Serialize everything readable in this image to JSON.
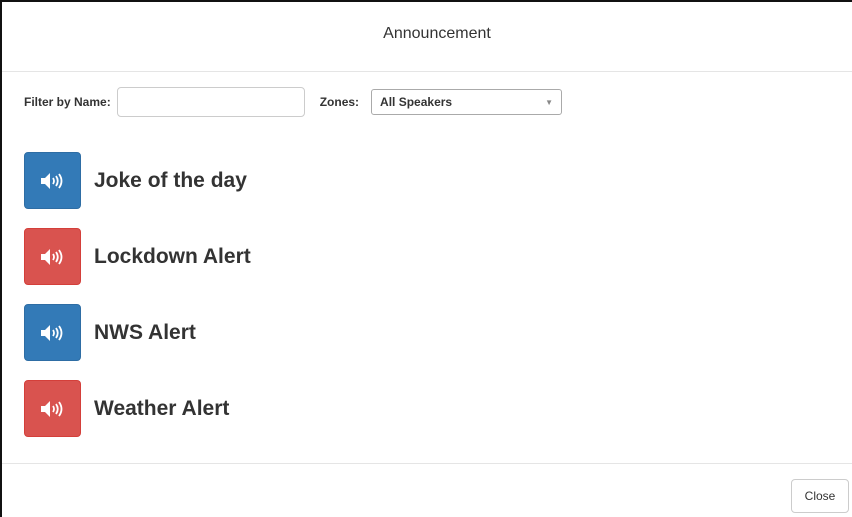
{
  "modal": {
    "title": "Announcement"
  },
  "filter": {
    "label": "Filter by Name:",
    "value": "",
    "placeholder": ""
  },
  "zones": {
    "label": "Zones:",
    "selected": "All Speakers"
  },
  "announcements": [
    {
      "label": "Joke of the day",
      "color": "#337ab7",
      "icon": "speaker-icon"
    },
    {
      "label": "Lockdown Alert",
      "color": "#d9534f",
      "icon": "speaker-icon"
    },
    {
      "label": "NWS Alert",
      "color": "#337ab7",
      "icon": "speaker-icon"
    },
    {
      "label": "Weather Alert",
      "color": "#d9534f",
      "icon": "speaker-icon"
    }
  ],
  "footer": {
    "close_label": "Close"
  }
}
